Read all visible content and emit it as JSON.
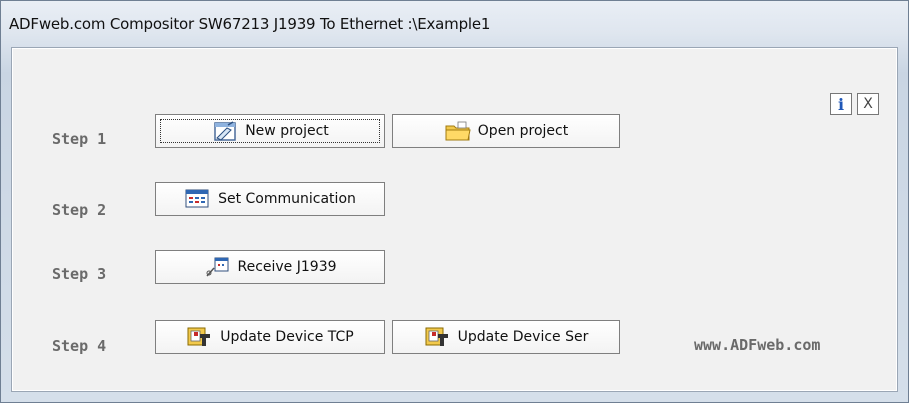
{
  "window": {
    "title": "ADFweb.com Compositor SW67213 J1939 To Ethernet :\\Example1"
  },
  "header_buttons": {
    "info_label": "i",
    "close_label": "X"
  },
  "steps": [
    {
      "label": "Step 1"
    },
    {
      "label": "Step 2"
    },
    {
      "label": "Step 3"
    },
    {
      "label": "Step 4"
    }
  ],
  "buttons": {
    "new_project": "New project",
    "open_project": "Open project",
    "set_communication": "Set Communication",
    "receive_j1939": "Receive J1939",
    "update_device_tcp": "Update Device TCP",
    "update_device_ser": "Update Device Ser"
  },
  "footer": {
    "website": "www.ADFweb.com"
  },
  "icons": {
    "new_project": "new-project-icon",
    "open_project": "folder-icon",
    "set_communication": "communication-settings-icon",
    "receive_j1939": "receive-icon",
    "update_tcp": "update-device-icon",
    "update_ser": "update-device-icon"
  }
}
